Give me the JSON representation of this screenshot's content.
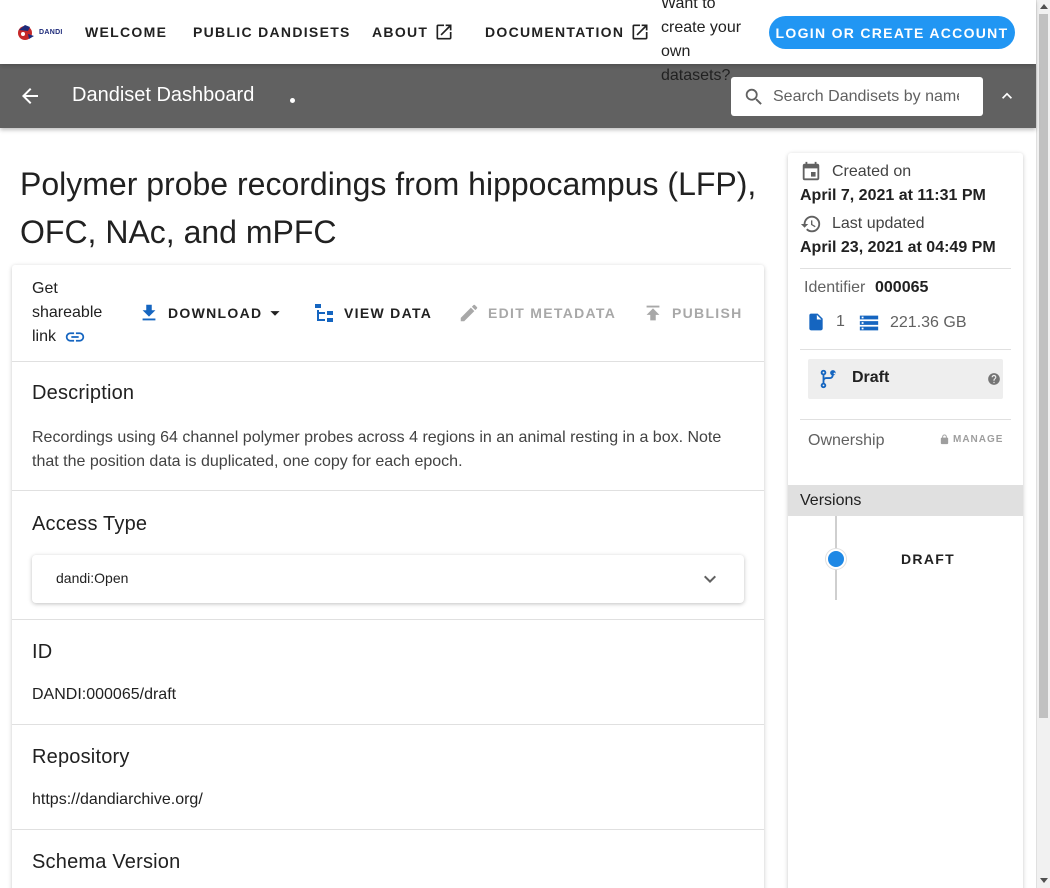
{
  "topbar": {
    "logo_text": "DANDI",
    "nav": [
      {
        "label": "WELCOME"
      },
      {
        "label": "PUBLIC DANDISETS"
      },
      {
        "label": "ABOUT"
      },
      {
        "label": "DOCUMENTATION"
      }
    ],
    "promo_text": "Want to create your own datasets?",
    "login_label": "LOGIN OR CREATE ACCOUNT",
    "accent_color": "#2196f3"
  },
  "toolbar": {
    "title": "Dandiset Dashboard",
    "search_placeholder": "Search Dandisets by name, description, identifier, or contributor name",
    "bar_color": "#616161"
  },
  "dandiset": {
    "title": "Polymer probe recordings from hippocampus (LFP), OFC, NAc, and mPFC",
    "actions": {
      "share_label": "Get shareable link",
      "download_label": "DOWNLOAD",
      "view_data_label": "VIEW DATA",
      "edit_metadata_label": "EDIT METADATA",
      "publish_label": "PUBLISH"
    },
    "sections": {
      "description_title": "Description",
      "description_text": "Recordings using 64 channel polymer probes across 4 regions in an animal resting in a box. Note that the position data is duplicated, one copy for each epoch.",
      "access_title": "Access Type",
      "access_value": "dandi:Open",
      "id_title": "ID",
      "id_value": "DANDI:000065/draft",
      "repo_title": "Repository",
      "repo_value": "https://dandiarchive.org/",
      "schema_title": "Schema Version"
    }
  },
  "sidebar": {
    "created_label": "Created on",
    "created_value": "April 7, 2021 at 11:31 PM",
    "updated_label": "Last updated",
    "updated_value": "April 23, 2021 at 04:49 PM",
    "identifier_label": "Identifier",
    "identifier_value": "000065",
    "file_count": "1",
    "size": "221.36 GB",
    "status": "Draft",
    "ownership_label": "Ownership",
    "manage_label": "MANAGE",
    "versions_label": "Versions",
    "versions": [
      {
        "label": "DRAFT"
      }
    ],
    "icon_color": "#1565c0"
  }
}
